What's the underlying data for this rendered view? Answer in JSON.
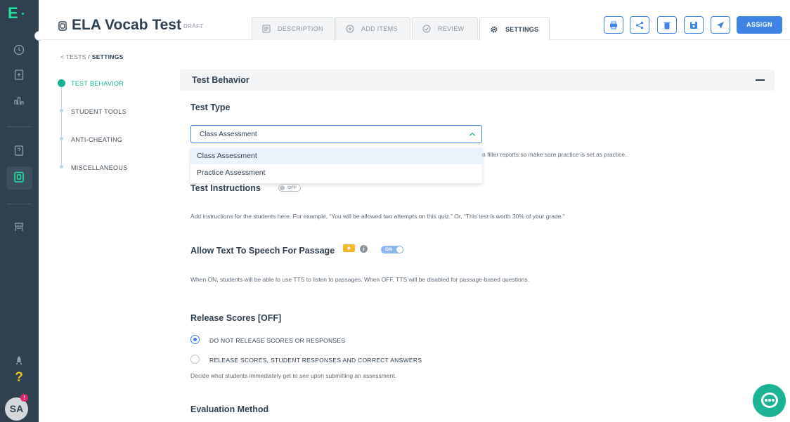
{
  "rail": {
    "logo": "E",
    "avatar_initials": "SA",
    "notification_badge": "!",
    "icons": [
      "clock-icon",
      "clipboard-add-icon",
      "bar-chart-icon",
      "question-bank-icon",
      "tests-icon",
      "playlist-icon",
      "rocket-icon",
      "help-icon"
    ]
  },
  "header": {
    "title": "ELA Vocab Test",
    "status": "DRAFT",
    "tabs": [
      {
        "label": "DESCRIPTION",
        "icon": "document-icon"
      },
      {
        "label": "ADD ITEMS",
        "icon": "plus-circle-icon"
      },
      {
        "label": "REVIEW",
        "icon": "check-circle-icon"
      },
      {
        "label": "SETTINGS",
        "icon": "gear-icon",
        "active": true
      }
    ],
    "actions": [
      "print-icon",
      "share-icon",
      "delete-icon",
      "save-icon",
      "publish-icon"
    ],
    "assign_label": "ASSIGN"
  },
  "breadcrumb": {
    "parent": "< TESTS",
    "separator": "/",
    "current": "SETTINGS"
  },
  "steps": [
    {
      "label": "TEST BEHAVIOR",
      "active": true
    },
    {
      "label": "STUDENT TOOLS",
      "active": false
    },
    {
      "label": "ANTI-CHEATING",
      "active": false
    },
    {
      "label": "MISCELLANEOUS",
      "active": false
    }
  ],
  "section": {
    "title": "Test Behavior"
  },
  "test_type": {
    "heading": "Test Type",
    "selected": "Class Assessment",
    "options": [
      "Class Assessment",
      "Practice Assessment"
    ],
    "hint_visible": "o filter reports so make sure practice is set as practice."
  },
  "test_instructions": {
    "heading": "Test Instructions",
    "toggle": "OFF",
    "description": "Add instructions for the students here. For example, “You will be allowed two attempts on this quiz.” Or, “This test is worth 30% of your grade.”"
  },
  "tts": {
    "heading": "Allow Text To Speech For Passage",
    "premium_badge": "★",
    "info": "i",
    "toggle": "ON",
    "description": "When ON, students will be able to use TTS to listen to passages. When OFF, TTS will be disabled for passage-based questions."
  },
  "release_scores": {
    "heading": "Release Scores [OFF]",
    "options": [
      {
        "label": "DO NOT RELEASE SCORES OR RESPONSES",
        "selected": true
      },
      {
        "label": "RELEASE SCORES, STUDENT RESPONSES AND CORRECT ANSWERS",
        "selected": false
      }
    ],
    "description": "Decide what students immediately get to see upon submitting an assessment."
  },
  "evaluation": {
    "heading": "Evaluation Method"
  },
  "colors": {
    "primary": "#3f84e5",
    "accent": "#1ab395",
    "rail": "#2f4151",
    "logo": "#1fe3a1"
  }
}
